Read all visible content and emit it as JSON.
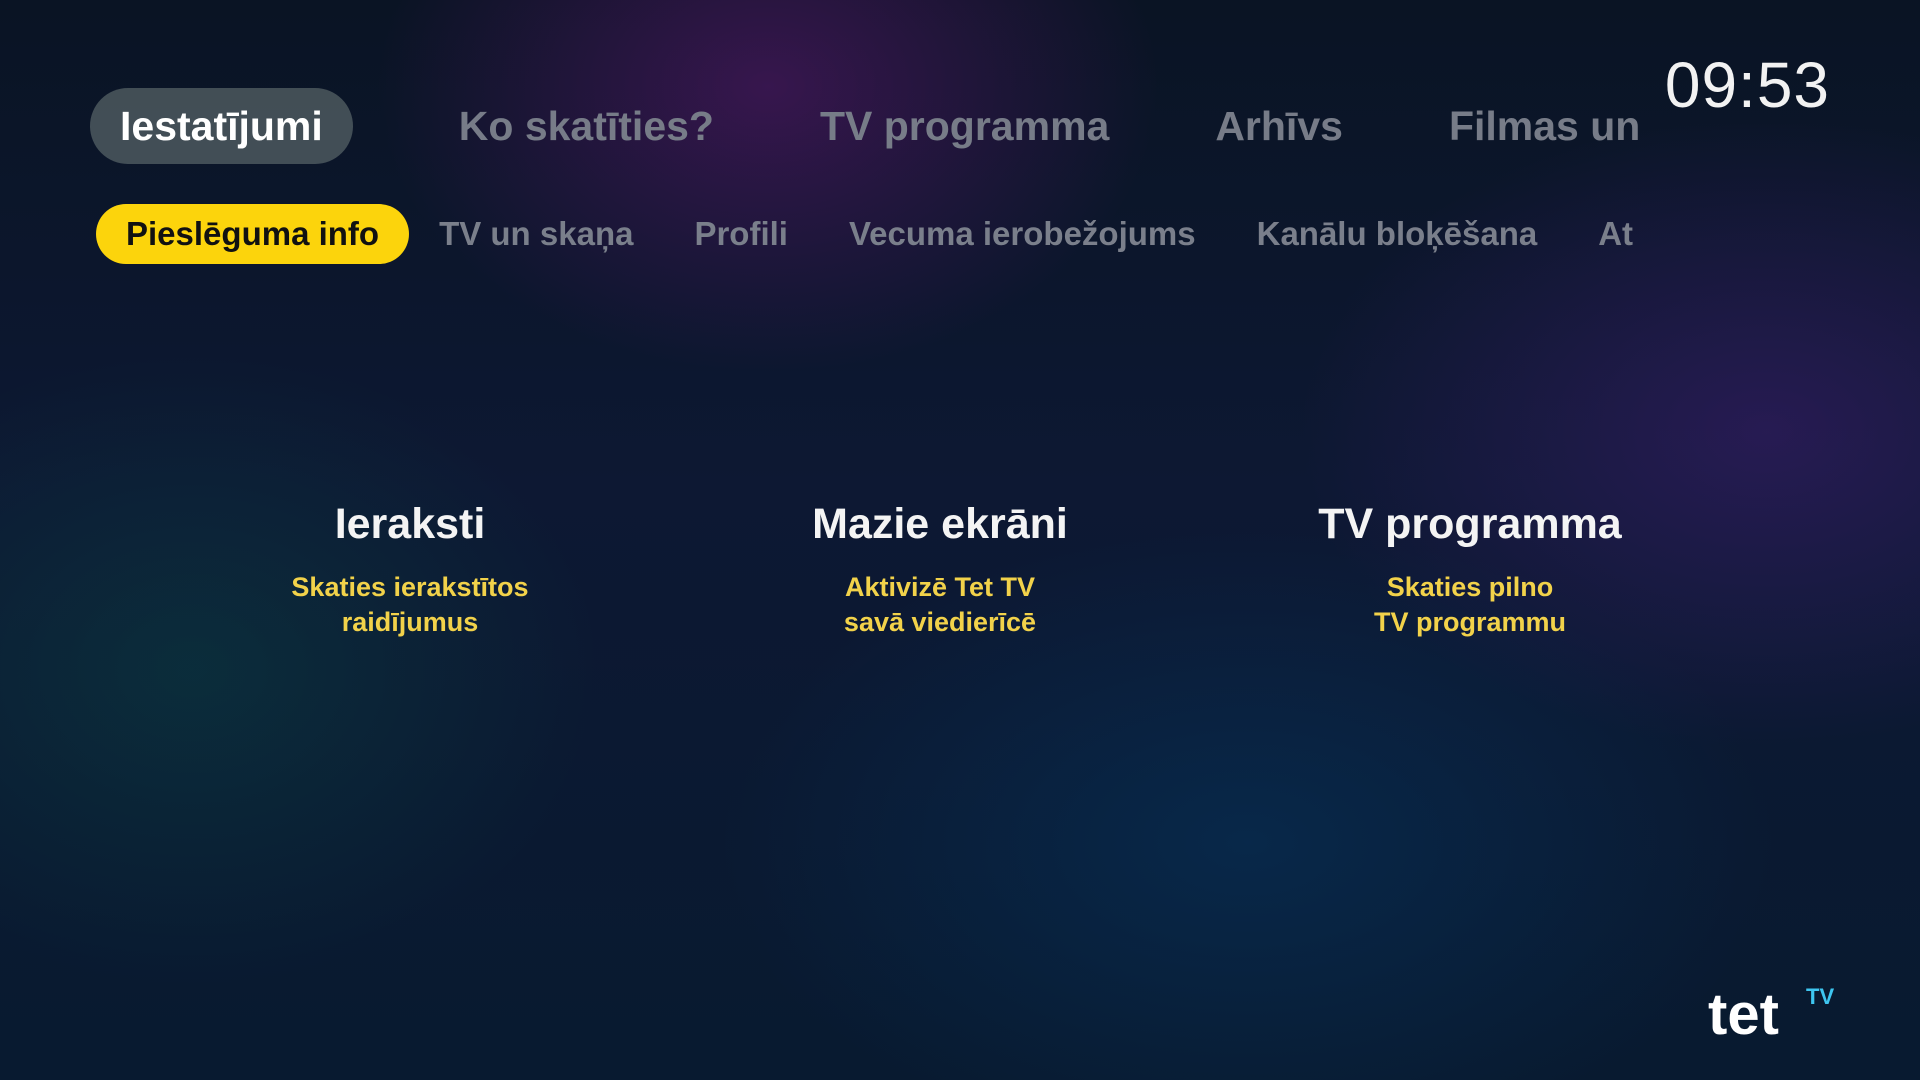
{
  "clock": "09:53",
  "main_nav": {
    "items": [
      "Iestatījumi",
      "Ko skatīties?",
      "TV programma",
      "Arhīvs",
      "Filmas un"
    ]
  },
  "sub_nav": {
    "items": [
      "Pieslēguma info",
      "TV un skaņa",
      "Profili",
      "Vecuma ierobežojums",
      "Kanālu bloķēšana",
      "At"
    ]
  },
  "cards": [
    {
      "title": "Ieraksti",
      "desc_line1": "Skaties ierakstītos",
      "desc_line2": "raidījumus"
    },
    {
      "title": "Mazie ekrāni",
      "desc_line1": "Aktivizē Tet TV",
      "desc_line2": "savā viedierīcē"
    },
    {
      "title": "TV programma",
      "desc_line1": "Skaties pilno",
      "desc_line2": "TV programmu"
    }
  ],
  "logo": {
    "word": "tet",
    "superscript": "TV"
  },
  "colors": {
    "accent_yellow": "#fcd40c",
    "desc_yellow": "#f2d24a",
    "logo_tv": "#3ec6f0"
  }
}
